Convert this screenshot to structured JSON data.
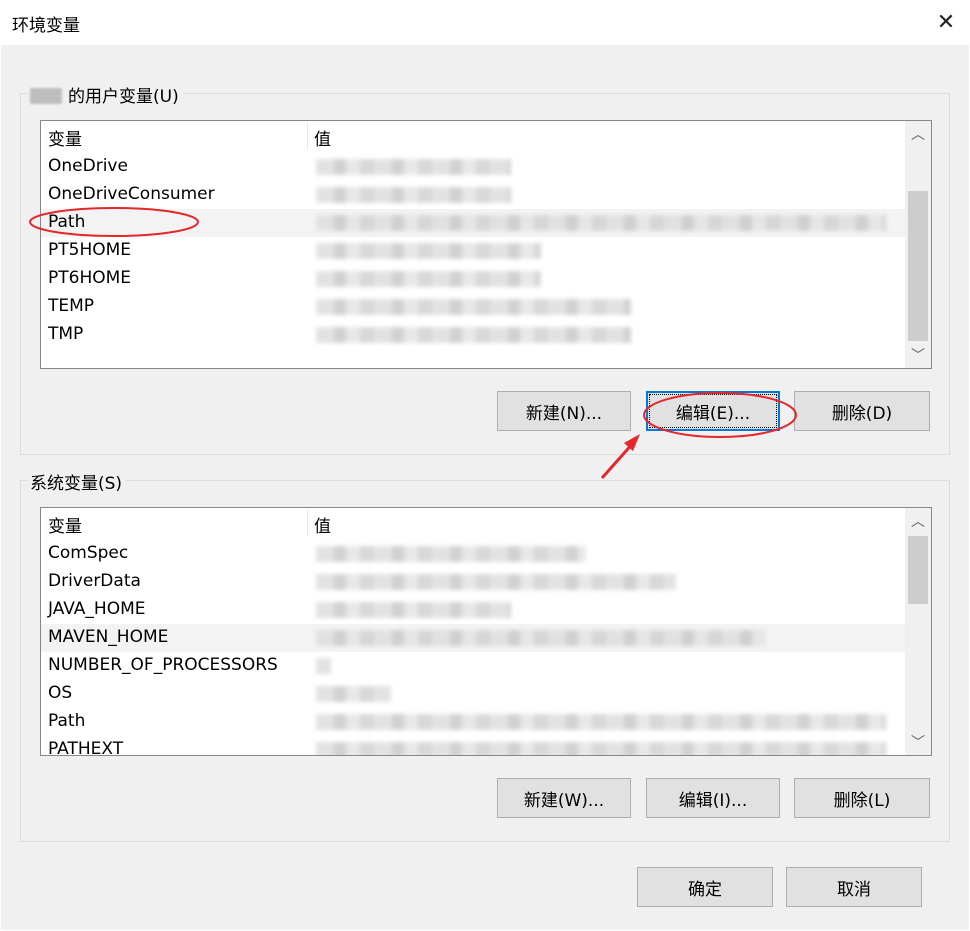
{
  "window": {
    "title": "环境变量",
    "close_glyph": "✕"
  },
  "user_group": {
    "label": "的用户变量(U)",
    "header": {
      "variable": "变量",
      "value": "值"
    },
    "rows": [
      {
        "name": "OneDrive",
        "value_len": 195
      },
      {
        "name": "OneDriveConsumer",
        "value_len": 195
      },
      {
        "name": "Path",
        "value_len": 570
      },
      {
        "name": "PT5HOME",
        "value_len": 225
      },
      {
        "name": "PT6HOME",
        "value_len": 225
      },
      {
        "name": "TEMP",
        "value_len": 315
      },
      {
        "name": "TMP",
        "value_len": 315
      }
    ],
    "buttons": {
      "new": "新建(N)...",
      "edit": "编辑(E)...",
      "delete": "删除(D)"
    }
  },
  "system_group": {
    "label": "系统变量(S)",
    "header": {
      "variable": "变量",
      "value": "值"
    },
    "rows": [
      {
        "name": "ComSpec",
        "value_len": 270
      },
      {
        "name": "DriverData",
        "value_len": 360
      },
      {
        "name": "JAVA_HOME",
        "value_len": 195
      },
      {
        "name": "MAVEN_HOME",
        "value_len": 450
      },
      {
        "name": "NUMBER_OF_PROCESSORS",
        "value_len": 15
      },
      {
        "name": "OS",
        "value_len": 75
      },
      {
        "name": "Path",
        "value_len": 570
      },
      {
        "name": "PATHEXT",
        "value_len": 570
      }
    ],
    "buttons": {
      "new": "新建(W)...",
      "edit": "编辑(I)...",
      "delete": "删除(L)"
    }
  },
  "footer": {
    "ok": "确定",
    "cancel": "取消"
  },
  "scroll": {
    "up": "︿",
    "down": "﹀"
  },
  "colors": {
    "annotation_red": "#e5262a",
    "focus_blue": "#0078d7"
  }
}
